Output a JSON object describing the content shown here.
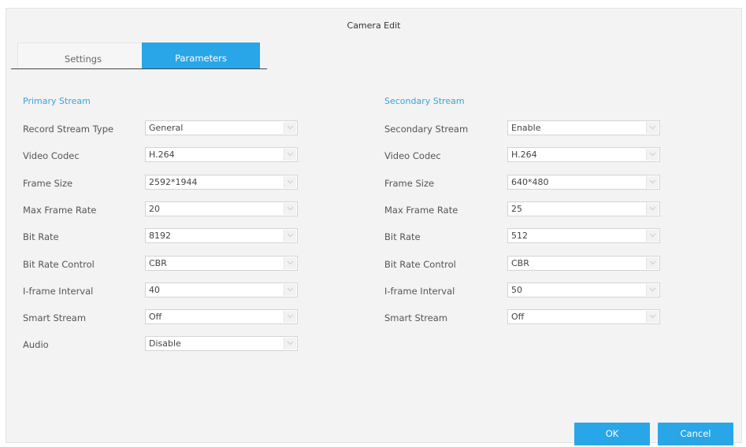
{
  "dialog": {
    "title": "Camera Edit"
  },
  "tabs": [
    {
      "label": "Settings",
      "active": false
    },
    {
      "label": "Parameters",
      "active": true
    }
  ],
  "primary": {
    "title": "Primary Stream",
    "rows": [
      {
        "label": "Record Stream Type",
        "value": "General"
      },
      {
        "label": "Video Codec",
        "value": "H.264"
      },
      {
        "label": "Frame Size",
        "value": "2592*1944"
      },
      {
        "label": "Max Frame Rate",
        "value": "20"
      },
      {
        "label": "Bit Rate",
        "value": "8192"
      },
      {
        "label": "Bit Rate Control",
        "value": "CBR"
      },
      {
        "label": "I-frame Interval",
        "value": "40"
      },
      {
        "label": "Smart Stream",
        "value": "Off"
      },
      {
        "label": "Audio",
        "value": "Disable"
      }
    ]
  },
  "secondary": {
    "title": "Secondary Stream",
    "rows": [
      {
        "label": "Secondary Stream",
        "value": "Enable"
      },
      {
        "label": "Video Codec",
        "value": "H.264"
      },
      {
        "label": "Frame Size",
        "value": "640*480"
      },
      {
        "label": "Max Frame Rate",
        "value": "25"
      },
      {
        "label": "Bit Rate",
        "value": "512"
      },
      {
        "label": "Bit Rate Control",
        "value": "CBR"
      },
      {
        "label": "I-frame Interval",
        "value": "50"
      },
      {
        "label": "Smart Stream",
        "value": "Off"
      }
    ]
  },
  "buttons": {
    "ok": "OK",
    "cancel": "Cancel"
  },
  "colors": {
    "accent": "#29a6e8",
    "section_title": "#34a4de",
    "background": "#f3f3f3"
  }
}
